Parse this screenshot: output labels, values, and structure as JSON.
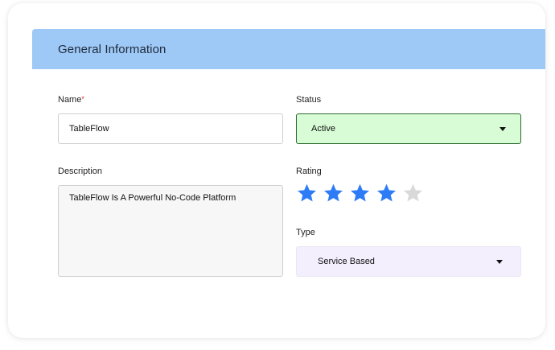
{
  "section": {
    "title": "General Information"
  },
  "form": {
    "name": {
      "label": "Name",
      "required_mark": "*",
      "value": "TableFlow"
    },
    "description": {
      "label": "Description",
      "value": "TableFlow Is A Powerful No-Code Platform"
    },
    "status": {
      "label": "Status",
      "value": "Active"
    },
    "rating": {
      "label": "Rating",
      "value": 4,
      "max": 5,
      "filled_color": "#2d7cf6",
      "empty_color": "#d9d9d9"
    },
    "type": {
      "label": "Type",
      "value": "Service Based"
    }
  },
  "colors": {
    "header_bg": "#9ec8f6",
    "status_bg": "#d8fdd6",
    "status_border": "#2d6a2d",
    "type_bg": "#f3effd"
  }
}
